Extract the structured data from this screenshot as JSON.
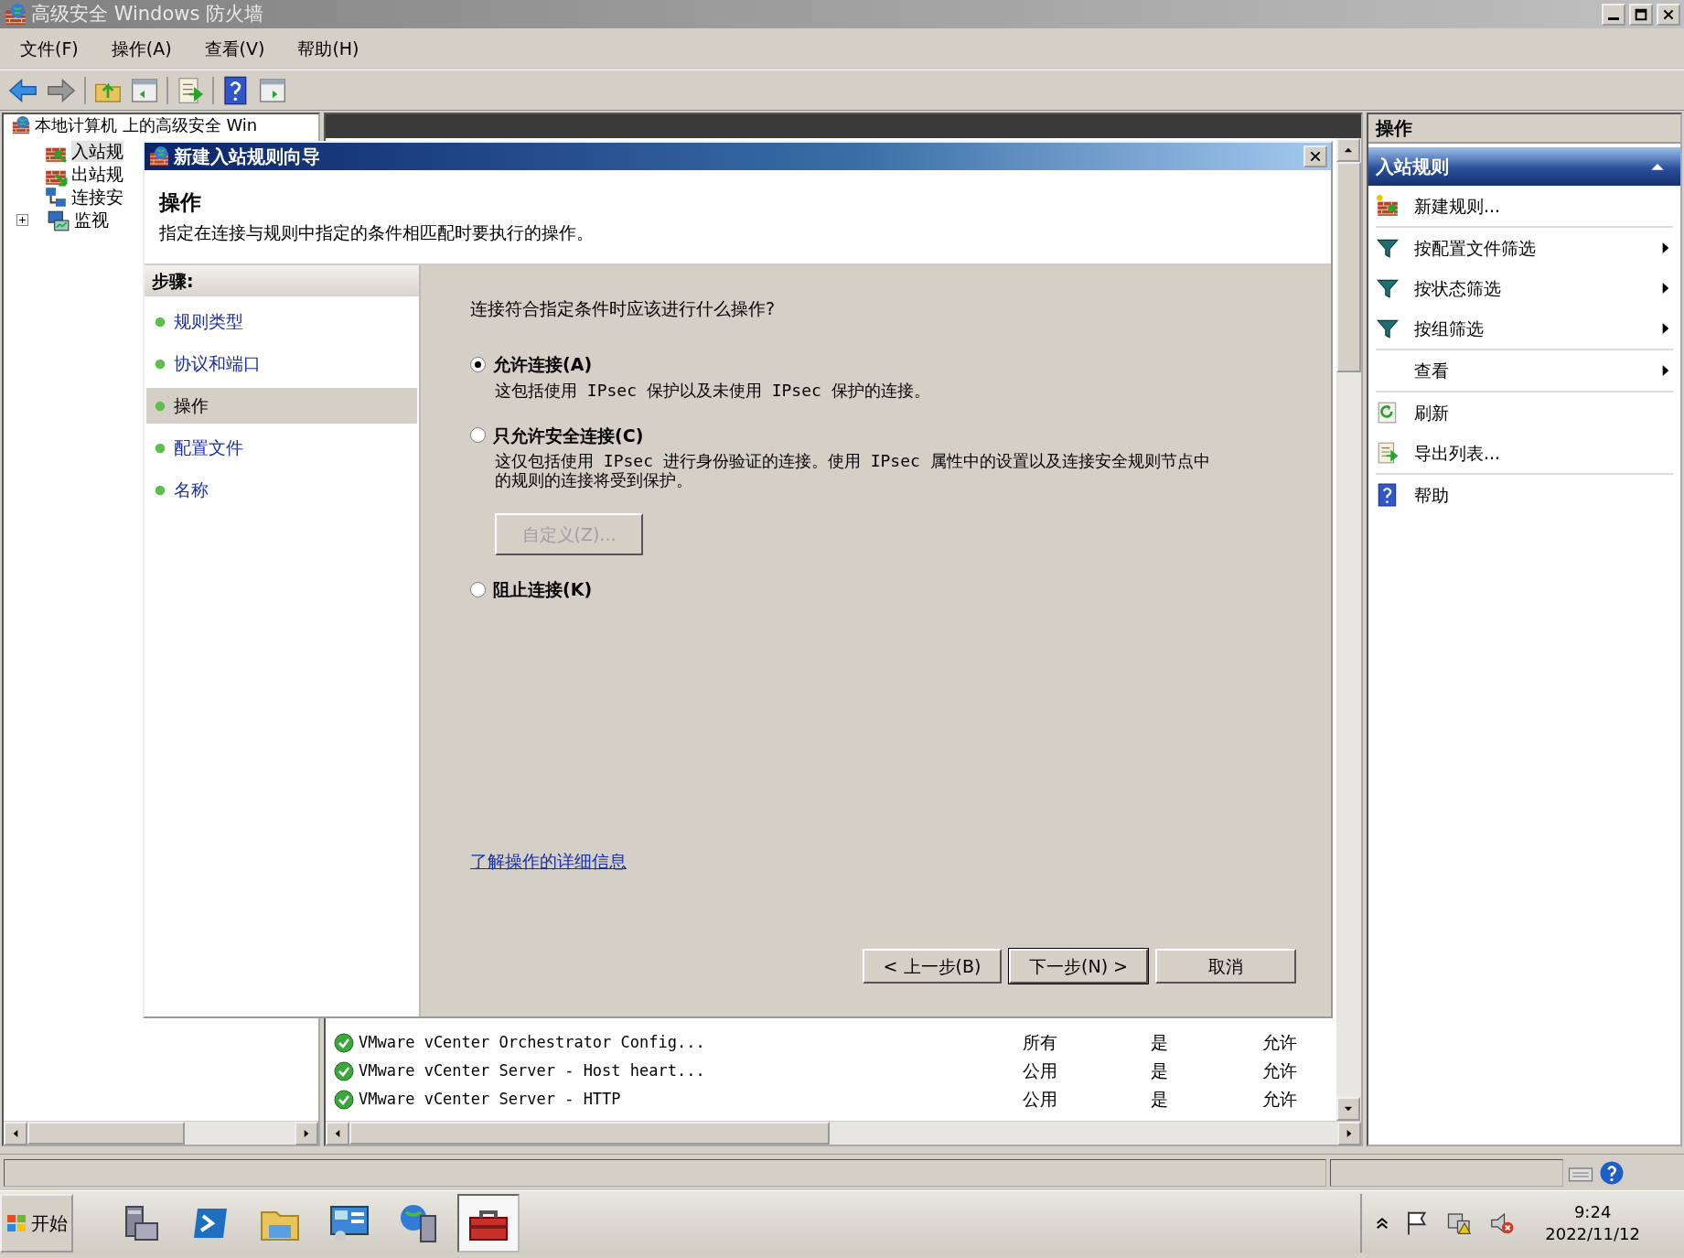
{
  "window": {
    "title": "高级安全 Windows 防火墙"
  },
  "menu": [
    {
      "label": "文件(F)"
    },
    {
      "label": "操作(A)"
    },
    {
      "label": "查看(V)"
    },
    {
      "label": "帮助(H)"
    }
  ],
  "tree": {
    "root": "本地计算机 上的高级安全 Win",
    "items": [
      {
        "label": "入站规",
        "kind": "inbound",
        "selected": true
      },
      {
        "label": "出站规",
        "kind": "outbound",
        "selected": false
      },
      {
        "label": "连接安",
        "kind": "connection",
        "selected": false
      },
      {
        "label": "监视",
        "kind": "monitor",
        "selected": false,
        "expanded": false
      }
    ]
  },
  "rules": [
    {
      "name": "VMware vCenter Orchestrator Config...",
      "profile": "所有",
      "enabled": "是",
      "action": "允许"
    },
    {
      "name": "VMware vCenter Server - Host heart...",
      "profile": "公用",
      "enabled": "是",
      "action": "允许"
    },
    {
      "name": "VMware vCenter Server - HTTP",
      "profile": "公用",
      "enabled": "是",
      "action": "允许"
    }
  ],
  "actions": {
    "title": "操作",
    "section": "入站规则",
    "items": [
      {
        "label": "新建规则...",
        "kind": "create",
        "submenu": false,
        "separator_after": true
      },
      {
        "label": "按配置文件筛选",
        "kind": "filter",
        "submenu": true,
        "separator_after": false
      },
      {
        "label": "按状态筛选",
        "kind": "filter",
        "submenu": true,
        "separator_after": false
      },
      {
        "label": "按组筛选",
        "kind": "filter",
        "submenu": true,
        "separator_after": true
      },
      {
        "label": "查看",
        "kind": "plain",
        "submenu": true,
        "separator_after": true
      },
      {
        "label": "刷新",
        "kind": "refresh",
        "submenu": false,
        "separator_after": false
      },
      {
        "label": "导出列表...",
        "kind": "export",
        "submenu": false,
        "separator_after": true
      },
      {
        "label": "帮助",
        "kind": "help",
        "submenu": false,
        "separator_after": false
      }
    ]
  },
  "dialog": {
    "title": "新建入站规则向导",
    "heading": "操作",
    "description": "指定在连接与规则中指定的条件相匹配时要执行的操作。",
    "steps_label": "步骤:",
    "steps": [
      {
        "label": "规则类型",
        "selected": false
      },
      {
        "label": "协议和端口",
        "selected": false
      },
      {
        "label": "操作",
        "selected": true
      },
      {
        "label": "配置文件",
        "selected": false
      },
      {
        "label": "名称",
        "selected": false
      }
    ],
    "question": "连接符合指定条件时应该进行什么操作?",
    "options": [
      {
        "label": "允许连接(A)",
        "description": "这包括使用 IPsec 保护以及未使用 IPsec 保护的连接。",
        "selected": true
      },
      {
        "label": "只允许安全连接(C)",
        "description": "这仅包括使用 IPsec 进行身份验证的连接。使用 IPsec 属性中的设置以及连接安全规则节点中的规则的连接将受到保护。",
        "selected": false,
        "button": {
          "label": "自定义(Z)...",
          "disabled": true
        }
      },
      {
        "label": "阻止连接(K)",
        "selected": false
      }
    ],
    "link": "了解操作的详细信息",
    "buttons": [
      {
        "label": "< 上一步(B)",
        "default": false
      },
      {
        "label": "下一步(N) >",
        "default": true
      },
      {
        "label": "取消",
        "default": false
      }
    ]
  },
  "taskbar": {
    "start": "开始",
    "apps": [
      {
        "kind": "server",
        "active": false
      },
      {
        "kind": "terminal",
        "active": false
      },
      {
        "kind": "folder",
        "active": false
      },
      {
        "kind": "panel",
        "active": false
      },
      {
        "kind": "globe",
        "active": false
      },
      {
        "kind": "toolbox",
        "active": true
      }
    ],
    "time": "9:24",
    "date": "2022/11/12"
  }
}
